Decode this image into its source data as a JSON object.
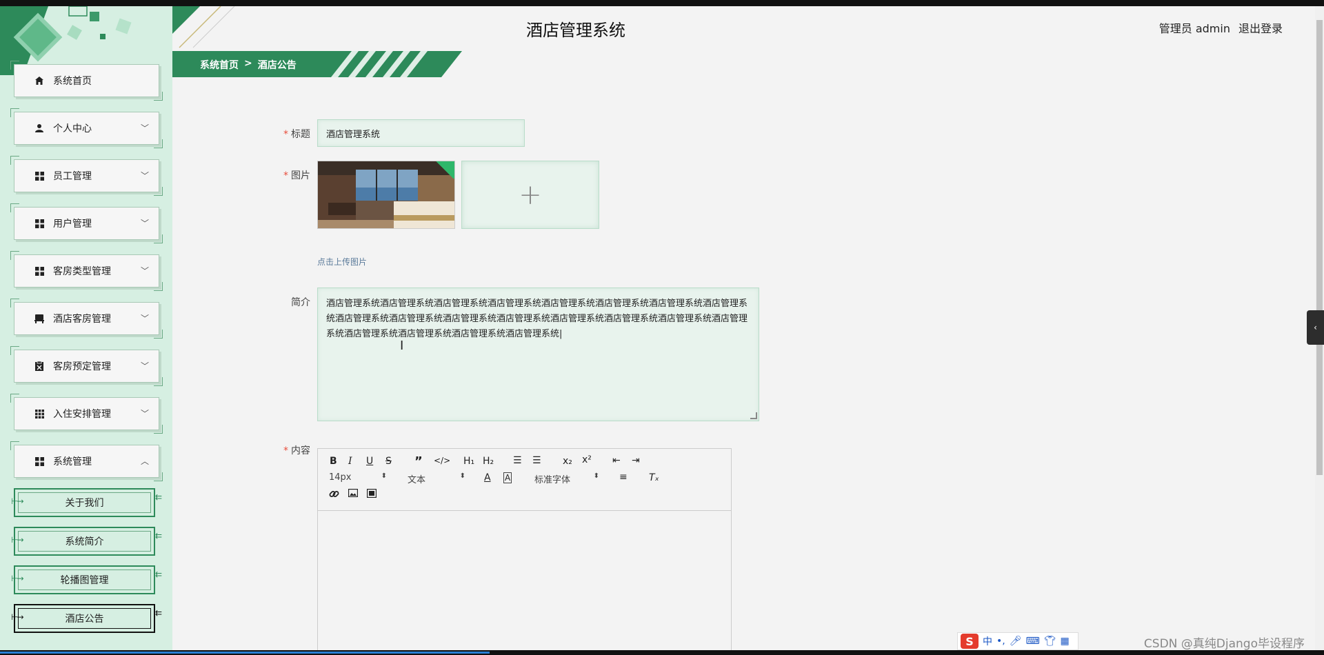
{
  "header": {
    "title": "酒店管理系统",
    "user_label": "管理员 admin",
    "logout_label": "退出登录"
  },
  "breadcrumb": {
    "home": "系统首页",
    "separator": ">",
    "current": "酒店公告"
  },
  "sidebar": {
    "items": [
      {
        "label": "系统首页",
        "icon": "home-icon"
      },
      {
        "label": "个人中心",
        "icon": "user-icon"
      },
      {
        "label": "员工管理",
        "icon": "grid-icon"
      },
      {
        "label": "用户管理",
        "icon": "grid-icon"
      },
      {
        "label": "客房类型管理",
        "icon": "grid-icon"
      },
      {
        "label": "酒店客房管理",
        "icon": "bed-icon"
      },
      {
        "label": "客房预定管理",
        "icon": "clipboard-icon"
      },
      {
        "label": "入住安排管理",
        "icon": "apps-icon"
      },
      {
        "label": "系统管理",
        "icon": "grid-icon"
      }
    ],
    "subitems": [
      {
        "label": "关于我们"
      },
      {
        "label": "系统简介"
      },
      {
        "label": "轮播图管理"
      },
      {
        "label": "酒店公告"
      }
    ]
  },
  "form": {
    "title_label": "标题",
    "title_value": "酒店管理系统",
    "image_label": "图片",
    "upload_hint": "点击上传图片",
    "intro_label": "简介",
    "intro_value": "酒店管理系统酒店管理系统酒店管理系统酒店管理系统酒店管理系统酒店管理系统酒店管理系统酒店管理系统酒店管理系统酒店管理系统酒店管理系统酒店管理系统酒店管理系统酒店管理系统酒店管理系统酒店管理系统酒店管理系统酒店管理系统酒店管理系统酒店管理系统|",
    "content_label": "内容"
  },
  "editor": {
    "font_size": "14px",
    "paragraph": "文本",
    "font_family": "标准字体"
  },
  "footer": {
    "watermark": "CSDN @真纯Django毕设程序",
    "ime_text": "中"
  },
  "colors": {
    "primary_green": "#2d8a5a",
    "sidebar_bg": "#d6efe2",
    "required_red": "#e84d3c"
  }
}
